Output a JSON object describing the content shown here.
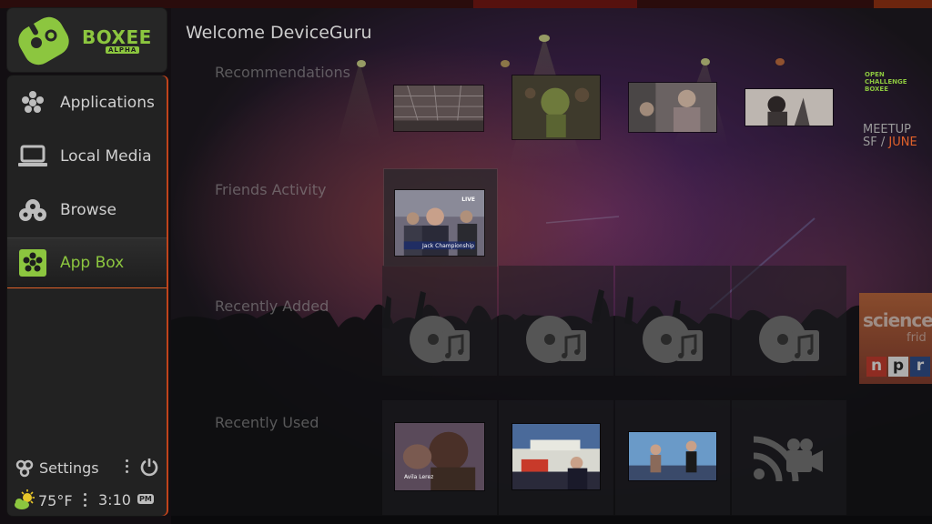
{
  "brand": {
    "name": "BOXEE",
    "edition": "ALPHA",
    "accent_color": "#8cc63f",
    "highlight_color": "#e0612a"
  },
  "sidebar": {
    "items": [
      {
        "label": "Applications",
        "icon": "applications-icon",
        "active": false
      },
      {
        "label": "Local Media",
        "icon": "laptop-icon",
        "active": false
      },
      {
        "label": "Browse",
        "icon": "browse-icon",
        "active": false
      },
      {
        "label": "App Box",
        "icon": "app-box-icon",
        "active": true
      }
    ],
    "settings_label": "Settings",
    "settings_icon": "settings-icon",
    "power_icon": "power-icon",
    "weather_icon": "partly-sunny-icon",
    "temperature": "75°F",
    "time": "3:10",
    "ampm": "PM"
  },
  "main": {
    "welcome": "Welcome DeviceGuru",
    "sections": {
      "recommendations": "Recommendations",
      "friends": "Friends Activity",
      "recently_added": "Recently Added",
      "recently_used": "Recently Used"
    },
    "side_promo": {
      "logo_lines": [
        "OPEN",
        "CHALLENGE",
        "BOXEE"
      ],
      "line1": "MEETUP",
      "line2_prefix": "SF / ",
      "line2_highlight": "JUNE"
    },
    "npr_tile": {
      "title": "science",
      "subtitle": "frid",
      "letters": [
        "n",
        "p",
        "r"
      ]
    },
    "friend_thumb": {
      "badge": "LIVE",
      "caption": "Jack Championship"
    },
    "recent_used_caption": "Avila Lerez"
  }
}
